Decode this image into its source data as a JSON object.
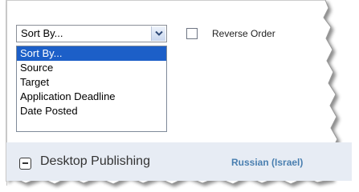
{
  "sort": {
    "selected_label": "Sort By...",
    "options": [
      "Sort By...",
      "Source",
      "Target",
      "Application Deadline",
      "Date Posted"
    ],
    "highlighted_index": 0
  },
  "reverse_order": {
    "label": "Reverse Order",
    "checked": false
  },
  "section": {
    "title": "Desktop Publishing",
    "language_link": "Russian (Israel)"
  },
  "colors": {
    "highlight": "#1c5fc8",
    "section_bg": "#e7ecf4",
    "link": "#4a7fb0"
  }
}
